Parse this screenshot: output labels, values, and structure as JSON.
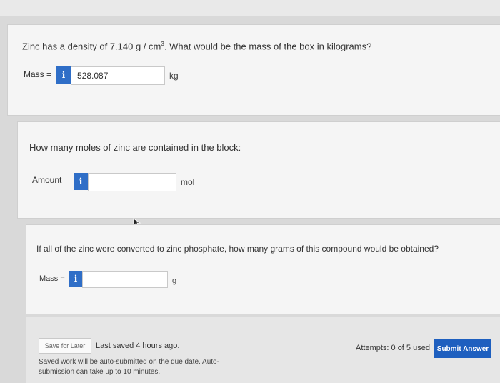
{
  "q1": {
    "question_prefix": "Zinc has a density of 7.140 g / cm",
    "question_sup": "3",
    "question_suffix": ". What would be the mass of the box in kilograms?",
    "label": "Mass =",
    "info": "i",
    "value": "528.087",
    "unit": "kg"
  },
  "q2": {
    "question": "How many moles of zinc are contained in the block:",
    "label": "Amount =",
    "info": "i",
    "value": "",
    "unit": "mol"
  },
  "q3": {
    "question": "If all of the zinc were converted to zinc phosphate, how many grams of this compound would be obtained?",
    "label": "Mass =",
    "info": "i",
    "value": "",
    "unit": "g"
  },
  "footer": {
    "save_for_later": "Save for Later",
    "last_saved": "Last saved 4 hours ago.",
    "note_line1": "Saved work will be auto-submitted on the due date. Auto-",
    "note_line2": "submission can take up to 10 minutes.",
    "attempts": "Attempts: 0 of 5 used",
    "submit": "Submit Answer"
  }
}
